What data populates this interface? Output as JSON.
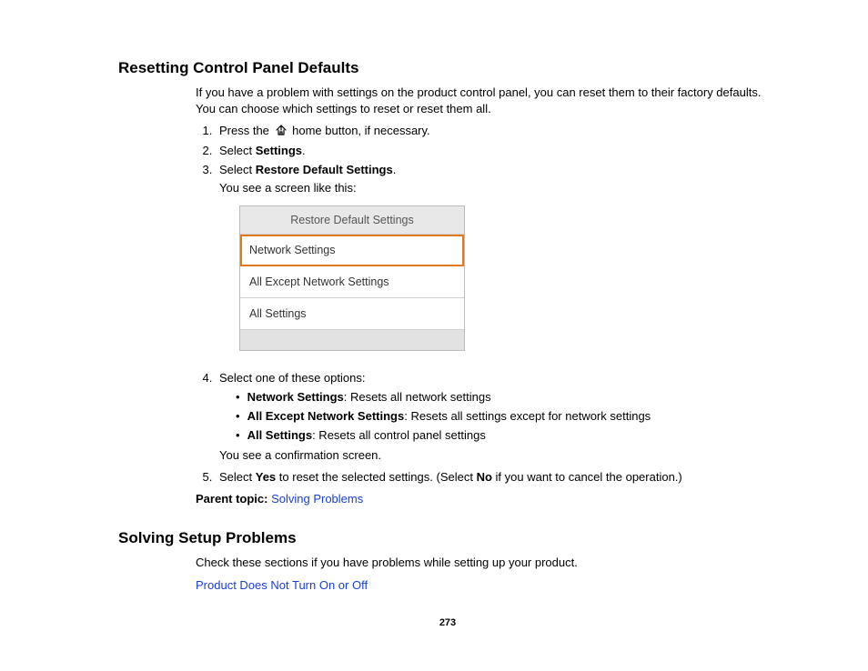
{
  "section1": {
    "heading": "Resetting Control Panel Defaults",
    "intro": "If you have a problem with settings on the product control panel, you can reset them to their factory defaults. You can choose which settings to reset or reset them all.",
    "step1_a": "Press the ",
    "step1_b": " home button, if necessary.",
    "step2_a": "Select ",
    "step2_b": "Settings",
    "step2_c": ".",
    "step3_a": "Select ",
    "step3_b": "Restore Default Settings",
    "step3_c": ".",
    "step3_note": "You see a screen like this:",
    "screenshot": {
      "header": "Restore Default Settings",
      "row1": "Network Settings",
      "row2": "All Except Network Settings",
      "row3": "All Settings"
    },
    "step4": "Select one of these options:",
    "opt1_b": "Network Settings",
    "opt1_t": ": Resets all network settings",
    "opt2_b": "All Except Network Settings",
    "opt2_t": ": Resets all settings except for network settings",
    "opt3_b": "All Settings",
    "opt3_t": ": Resets all control panel settings",
    "step4_note": "You see a confirmation screen.",
    "step5_a": "Select ",
    "step5_b": "Yes",
    "step5_c": " to reset the selected settings. (Select ",
    "step5_d": "No",
    "step5_e": " if you want to cancel the operation.)",
    "parent_label": "Parent topic: ",
    "parent_link": "Solving Problems"
  },
  "section2": {
    "heading": "Solving Setup Problems",
    "intro": "Check these sections if you have problems while setting up your product.",
    "link1": "Product Does Not Turn On or Off"
  },
  "pagenum": "273"
}
